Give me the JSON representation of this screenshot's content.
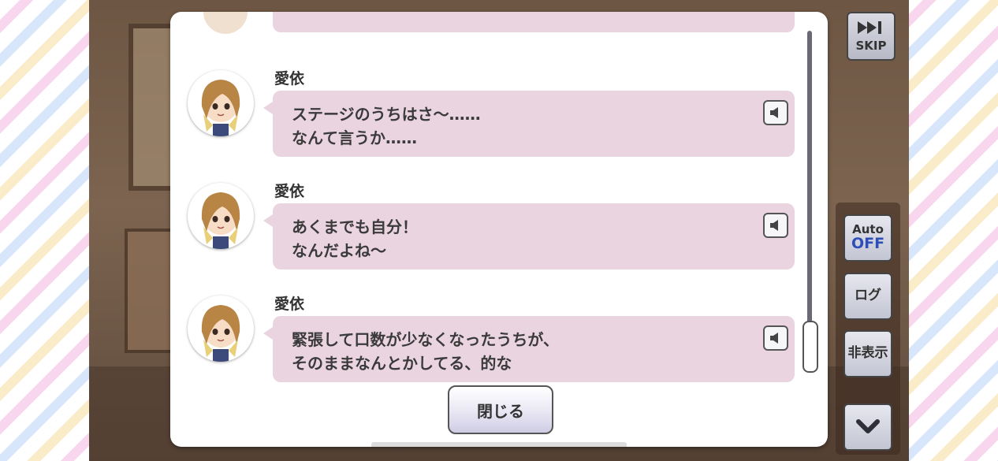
{
  "log": {
    "entries": [
      {
        "speaker": "愛依",
        "line1": "ステージのうちはさ〜……",
        "line2": "なんて言うか……"
      },
      {
        "speaker": "愛依",
        "line1": "あくまでも自分！",
        "line2": "なんだよね〜"
      },
      {
        "speaker": "愛依",
        "line1": "緊張して口数が少なくなったうちが、",
        "line2": "そのままなんとかしてる、的な"
      }
    ],
    "close_label": "閉じる",
    "scroll_fraction": 1.0
  },
  "controls": {
    "skip_label": "SKIP",
    "auto_label": "Auto",
    "auto_state": "OFF",
    "log_label": "ログ",
    "hide_label": "非表示"
  },
  "colors": {
    "bubble": "#ead4e0",
    "auto_off": "#2f4fb8"
  },
  "icons": [
    "speaker-icon",
    "skip-icon",
    "chevron-down-icon"
  ]
}
